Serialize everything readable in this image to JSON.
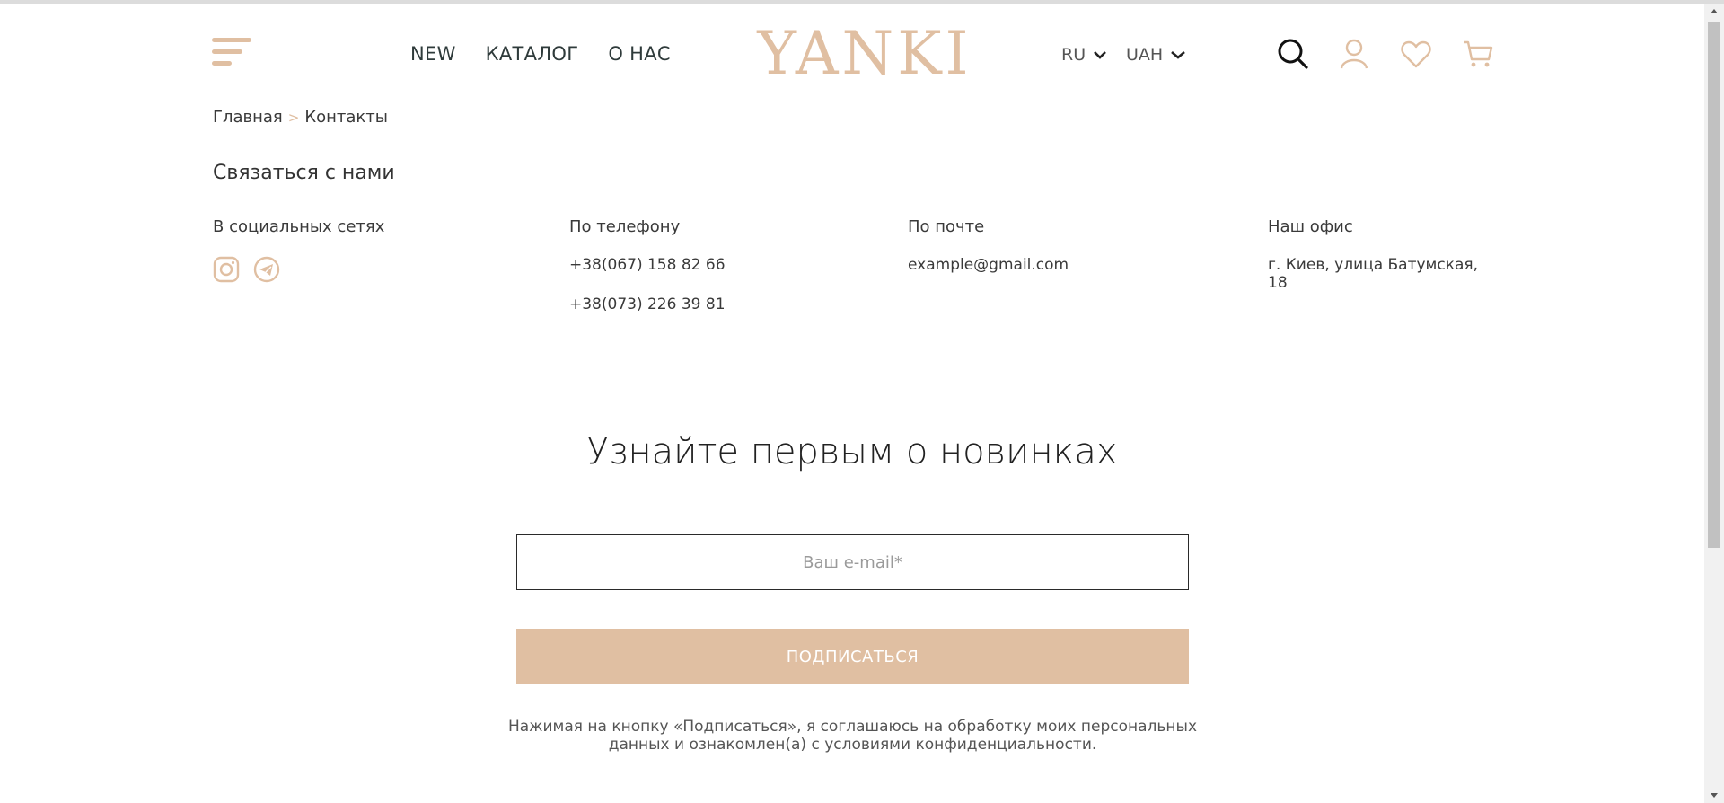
{
  "header": {
    "nav": [
      "NEW",
      "КАТАЛОГ",
      "О НАС"
    ],
    "logo": "YANKI",
    "language": "RU",
    "currency": "UAH"
  },
  "breadcrumb": {
    "home": "Главная",
    "separator": ">",
    "current": "Контакты"
  },
  "contacts": {
    "title": "Связаться с нами",
    "social": {
      "heading": "В социальных сетях",
      "icons": [
        "instagram-icon",
        "telegram-icon"
      ]
    },
    "phone": {
      "heading": "По телефону",
      "numbers": [
        "+38(067) 158 82 66",
        "+38(073) 226 39 81"
      ]
    },
    "email": {
      "heading": "По почте",
      "address": "example@gmail.com"
    },
    "office": {
      "heading": "Наш офис",
      "address": "г. Киев, улица Батумская, 18"
    }
  },
  "subscribe": {
    "title": "Узнайте первым о новинках",
    "email_placeholder": "Ваш e-mail*",
    "button_label": "ПОДПИСАТЬСЯ",
    "consent": "Нажимая на кнопку «Подписаться», я соглашаюсь на обработку моих персональных данных и ознакомлен(а) с условиями конфиденциальности."
  },
  "colors": {
    "accent": "#e0bfa2",
    "text": "#333333",
    "border": "#2a2a2a"
  }
}
